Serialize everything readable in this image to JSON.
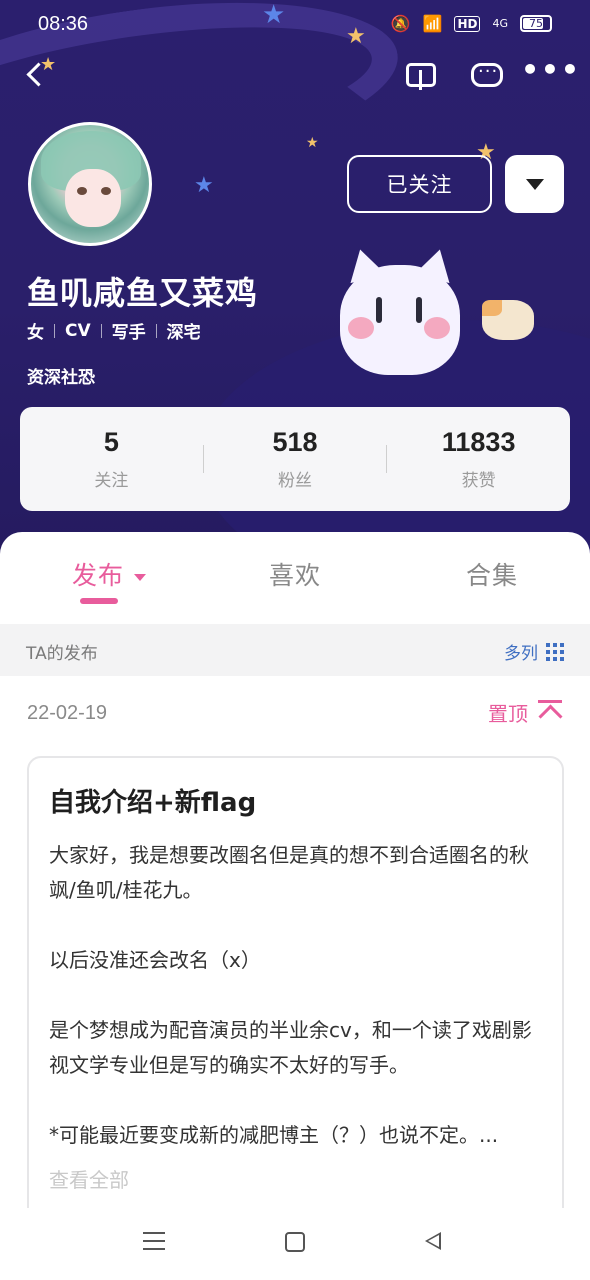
{
  "status_bar": {
    "time": "08:36",
    "network": "4G",
    "hd": "HD",
    "battery": "75"
  },
  "colors": {
    "header_bg": "#2b1f6e",
    "accent_pink": "#e85c9c",
    "link_blue": "#3f6fc2"
  },
  "profile": {
    "name": "鱼叽咸鱼又菜鸡",
    "tags": [
      "女",
      "CV",
      "写手",
      "深宅"
    ],
    "title_tag": "资深社恐",
    "follow_label": "已关注"
  },
  "stats": [
    {
      "value": "5",
      "label": "关注"
    },
    {
      "value": "518",
      "label": "粉丝"
    },
    {
      "value": "11833",
      "label": "获赞"
    }
  ],
  "tabs": [
    {
      "label": "发布",
      "active": true
    },
    {
      "label": "喜欢",
      "active": false
    },
    {
      "label": "合集",
      "active": false
    }
  ],
  "subbar": {
    "left_label": "TA的发布",
    "right_label": "多列"
  },
  "post": {
    "date": "22-02-19",
    "pin_label": "置顶",
    "title": "自我介绍+新flag",
    "paragraphs": [
      "大家好，我是想要改圈名但是真的想不到合适圈名的秋飒/鱼叽/桂花九。",
      "以后没准还会改名（x）",
      "是个梦想成为配音演员的半业余cv，和一个读了戏剧影视文学专业但是写的确实不太好的写手。",
      "*可能最近要变成新的减肥博主（？）也说不定。..."
    ],
    "more_label": "查看全部"
  }
}
